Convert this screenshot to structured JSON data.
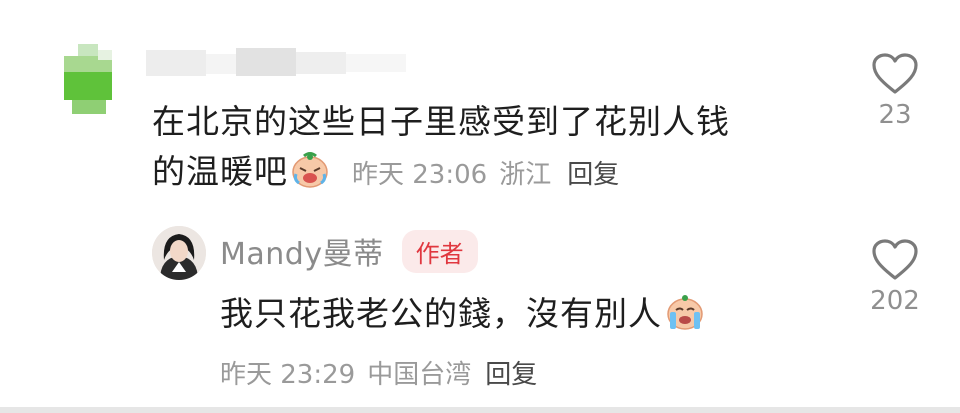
{
  "comment": {
    "text_line1": "在北京的这些日子里感受到了花别人钱",
    "text_line2": "的温暖吧",
    "time": "昨天 23:06",
    "location": "浙江",
    "reply_label": "回复",
    "likes": "23",
    "emoji_icon": "laughing-crying-emoji"
  },
  "reply": {
    "author": "Mandy曼蒂",
    "badge": "作者",
    "text": "我只花我老公的錢，沒有別人",
    "time": "昨天 23:29",
    "location": "中国台湾",
    "reply_label": "回复",
    "likes": "202",
    "emoji_icon": "sobbing-emoji"
  },
  "colors": {
    "text": "#1e1e1e",
    "meta": "#9a9a9a",
    "badge_bg": "#fbeaea",
    "badge_text": "#e0373f"
  }
}
